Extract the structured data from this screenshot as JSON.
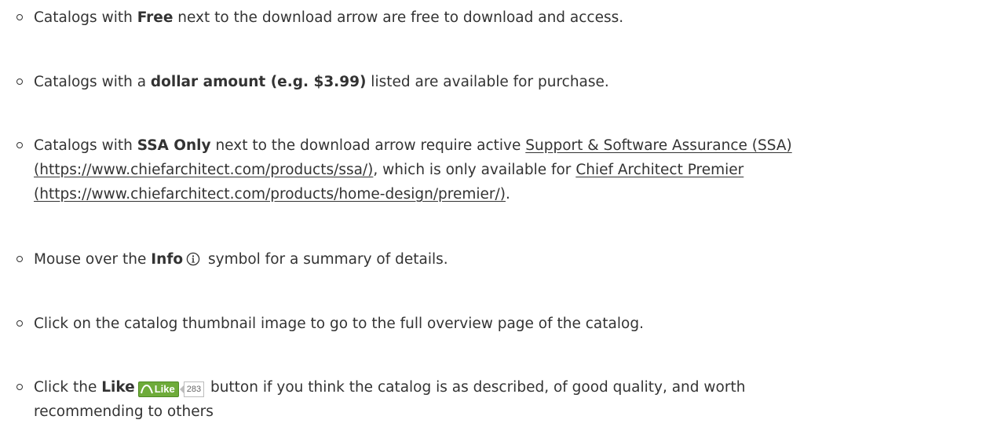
{
  "items": [
    {
      "prefix": "Catalogs with ",
      "bold": "Free",
      "suffix": " next to the download arrow are free to download and access."
    },
    {
      "prefix": "Catalogs with a ",
      "bold": "dollar amount (e.g. $3.99)",
      "suffix": " listed are available for purchase."
    },
    {
      "prefix": "Catalogs with ",
      "bold": "SSA Only",
      "mid": " next to the download arrow require active ",
      "link1": "Support & Software Assurance (SSA)",
      "link1_url": "(https://www.chiefarchitect.com/products/ssa/)",
      "mid2": ", which is only available for ",
      "link2": "Chief Architect Premier",
      "link2_url": "(https://www.chiefarchitect.com/products/home-design/premier/)",
      "end": "."
    },
    {
      "prefix": "Mouse over the ",
      "bold": "Info",
      "icon": "info-circle-icon",
      "suffix": " symbol for a summary of details."
    },
    {
      "text": "Click on the catalog thumbnail image to go to the full overview page of the catalog."
    },
    {
      "prefix": "Click the ",
      "bold": "Like",
      "like_label": "Like",
      "like_count": "283",
      "suffix": " button if you think the catalog is as described, of good quality, and worth",
      "line2": "recommending to others"
    }
  ],
  "colors": {
    "text": "#333333",
    "like_green": "#6eab3a"
  }
}
